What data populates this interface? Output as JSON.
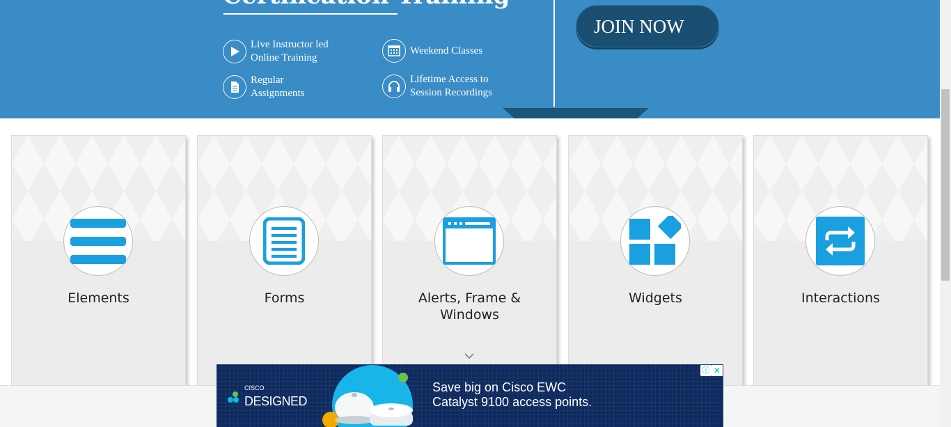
{
  "banner": {
    "title": "Certification Training",
    "features": [
      {
        "icon": "play-icon",
        "lines": [
          "Live Instructor led",
          "Online Training"
        ]
      },
      {
        "icon": "calendar-icon",
        "lines": [
          "Weekend Classes"
        ]
      },
      {
        "icon": "document-icon",
        "lines": [
          "Regular",
          "Assignments"
        ]
      },
      {
        "icon": "headphones-icon",
        "lines": [
          "Lifetime Access to",
          "Session Recordings"
        ]
      }
    ],
    "join_label": "JOIN NOW",
    "colors": {
      "background": "#3a8cc7",
      "button": "#1b4f72"
    }
  },
  "cards": [
    {
      "label": "Elements",
      "icon": "hamburger-menu-icon"
    },
    {
      "label": "Forms",
      "icon": "form-document-icon"
    },
    {
      "label": "Alerts, Frame & Windows",
      "icon": "browser-window-icon"
    },
    {
      "label": "Widgets",
      "icon": "widgets-icon"
    },
    {
      "label": "Interactions",
      "icon": "interactions-arrows-icon"
    }
  ],
  "card_accent": "#1a9fe0",
  "ad": {
    "brand_small": "CISCO",
    "brand_big": "DESIGNED",
    "line1": "Save big on Cisco EWC",
    "line2": "Catalyst 9100 access points.",
    "info_symbol": "ⓘ",
    "close_symbol": "✕"
  }
}
